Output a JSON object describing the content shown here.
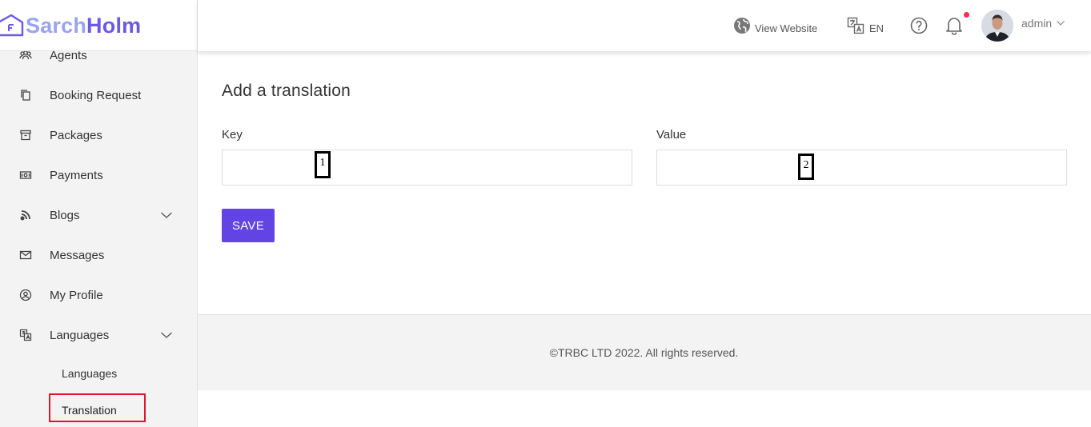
{
  "brand": {
    "part1": "Sarch",
    "part2": "Holm",
    "color_light": "#9aa3f2",
    "color_dark": "#6a5ae6"
  },
  "sidebar": {
    "items": [
      {
        "label": "Agents",
        "icon": "agents-icon"
      },
      {
        "label": "Booking Request",
        "icon": "copy-icon"
      },
      {
        "label": "Packages",
        "icon": "archive-icon"
      },
      {
        "label": "Payments",
        "icon": "money-icon"
      },
      {
        "label": "Blogs",
        "icon": "rss-icon",
        "expandable": true
      },
      {
        "label": "Messages",
        "icon": "mail-icon"
      },
      {
        "label": "My Profile",
        "icon": "user-circle-icon"
      },
      {
        "label": "Languages",
        "icon": "translate-icon",
        "expandable": true
      }
    ],
    "sub_items": [
      {
        "label": "Languages"
      },
      {
        "label": "Translation",
        "active": true
      }
    ]
  },
  "header": {
    "view_website": "View Website",
    "language": "EN",
    "user_name": "admin",
    "notification_color": "#f0304c"
  },
  "main": {
    "title": "Add a translation",
    "key_label": "Key",
    "value_label": "Value",
    "key_value": "",
    "value_value": "",
    "save_label": "SAVE",
    "accent_color": "#6244e4",
    "markers": [
      "1",
      "2"
    ]
  },
  "footer": {
    "text": "©TRBC LTD 2022. All rights reserved."
  }
}
